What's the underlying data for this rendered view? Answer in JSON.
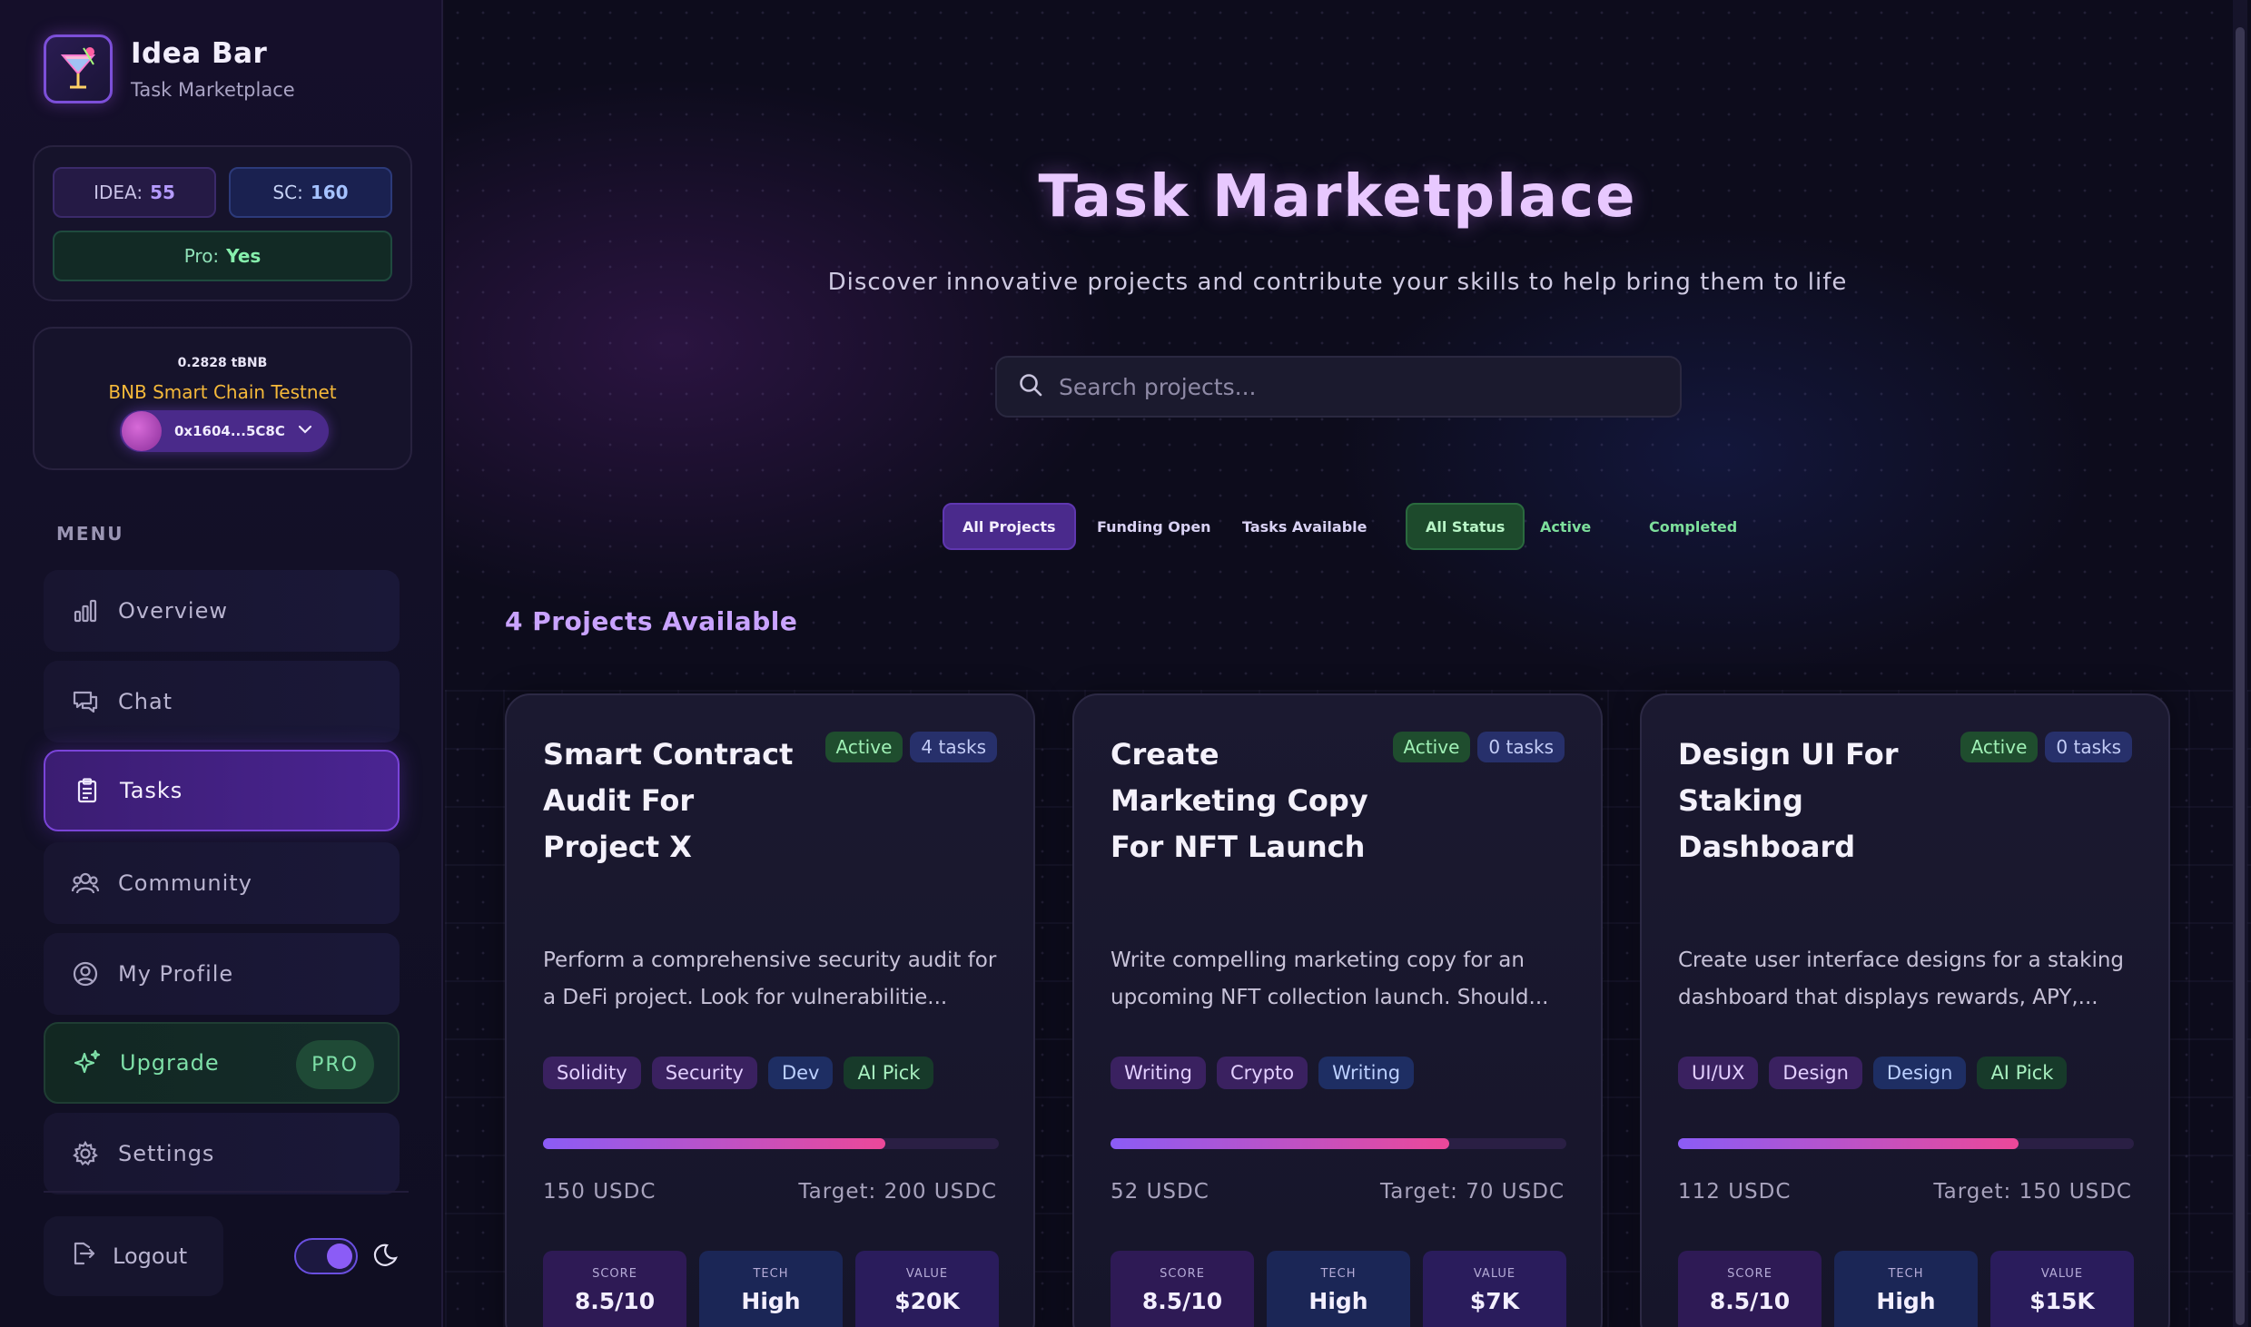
{
  "brand": {
    "title": "Idea Bar",
    "subtitle": "Task Marketplace"
  },
  "balances": {
    "idea_label": "IDEA:",
    "idea_value": "55",
    "sc_label": "SC:",
    "sc_value": "160",
    "pro_label": "Pro:",
    "pro_value": "Yes"
  },
  "wallet": {
    "amount": "0.2828 tBNB",
    "chain": "BNB Smart Chain Testnet",
    "address": "0x1604...5C8C"
  },
  "menu": {
    "label": "MENU",
    "items": [
      {
        "label": "Overview",
        "icon": "bar-chart-icon"
      },
      {
        "label": "Chat",
        "icon": "chat-icon"
      },
      {
        "label": "Tasks",
        "icon": "clipboard-icon"
      },
      {
        "label": "Community",
        "icon": "users-icon"
      },
      {
        "label": "My Profile",
        "icon": "user-circle-icon"
      },
      {
        "label": "Upgrade",
        "icon": "sparkles-icon",
        "badge": "PRO"
      },
      {
        "label": "Settings",
        "icon": "gear-icon"
      }
    ],
    "logout": "Logout"
  },
  "hero": {
    "title": "Task Marketplace",
    "subtitle": "Discover innovative projects and contribute your skills to help bring them to life"
  },
  "search": {
    "placeholder": "Search projects..."
  },
  "filters": {
    "type": [
      "All Projects",
      "Funding Open",
      "Tasks Available"
    ],
    "status": [
      "All Status",
      "Active",
      "Completed"
    ]
  },
  "projects_count": "4 Projects Available",
  "cards": [
    {
      "title": "Smart Contract Audit For Project X",
      "status": "Active",
      "tasks": "4 tasks",
      "description": "Perform a comprehensive security audit for a DeFi project. Look for vulnerabilitie...",
      "tags": [
        "Solidity",
        "Security",
        "Dev",
        "AI Pick"
      ],
      "progress": 0.75,
      "raised": "150 USDC",
      "target": "Target: 200 USDC",
      "score_label": "SCORE",
      "score": "8.5/10",
      "tech_label": "TECH",
      "tech": "High",
      "value_label": "VALUE",
      "value": "$20K"
    },
    {
      "title": "Create Marketing Copy For NFT Launch",
      "status": "Active",
      "tasks": "0 tasks",
      "description": "Write compelling marketing copy for an upcoming NFT collection launch. Should...",
      "tags": [
        "Writing",
        "Crypto",
        "Writing"
      ],
      "progress": 0.743,
      "raised": "52 USDC",
      "target": "Target: 70 USDC",
      "score_label": "SCORE",
      "score": "8.5/10",
      "tech_label": "TECH",
      "tech": "High",
      "value_label": "VALUE",
      "value": "$7K"
    },
    {
      "title": "Design UI For Staking Dashboard",
      "status": "Active",
      "tasks": "0 tasks",
      "description": "Create user interface designs for a staking dashboard that displays rewards, APY,...",
      "tags": [
        "UI/UX",
        "Design",
        "Design",
        "AI Pick"
      ],
      "progress": 0.747,
      "raised": "112 USDC",
      "target": "Target: 150 USDC",
      "score_label": "SCORE",
      "score": "8.5/10",
      "tech_label": "TECH",
      "tech": "High",
      "value_label": "VALUE",
      "value": "$15K"
    }
  ]
}
